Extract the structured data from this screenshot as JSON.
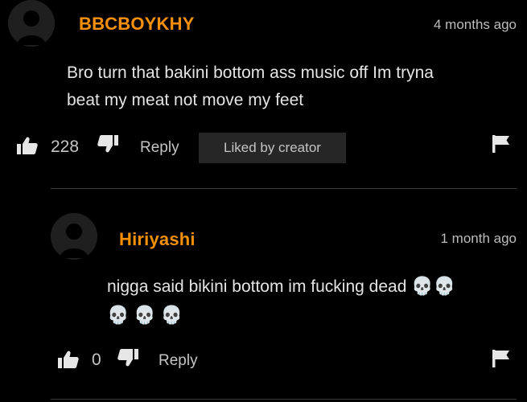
{
  "comments": [
    {
      "username": "BBCBOYKHY",
      "timestamp": "4 months ago",
      "text_line1": "Bro turn that bakini bottom ass music off Im tryna",
      "text_line2": "beat my meat not move my feet",
      "likes": "228",
      "reply_label": "Reply",
      "badge": "Liked by creator"
    },
    {
      "username": "Hiriyashi",
      "timestamp": "1 month ago",
      "text_line1": "nigga said bikini bottom im fucking dead",
      "emoji": "💀",
      "likes": "0",
      "reply_label": "Reply"
    }
  ],
  "icons": {
    "like": "thumbs-up-icon",
    "dislike": "thumbs-down-icon",
    "flag": "flag-icon",
    "avatar": "default-avatar-icon",
    "skull": "skull-emoji"
  },
  "colors": {
    "background": "#000000",
    "username": "#f79009",
    "text": "#e4e4e4",
    "muted": "#c4c4c4",
    "badge_bg": "#262626",
    "divider": "#3a3a3a"
  }
}
